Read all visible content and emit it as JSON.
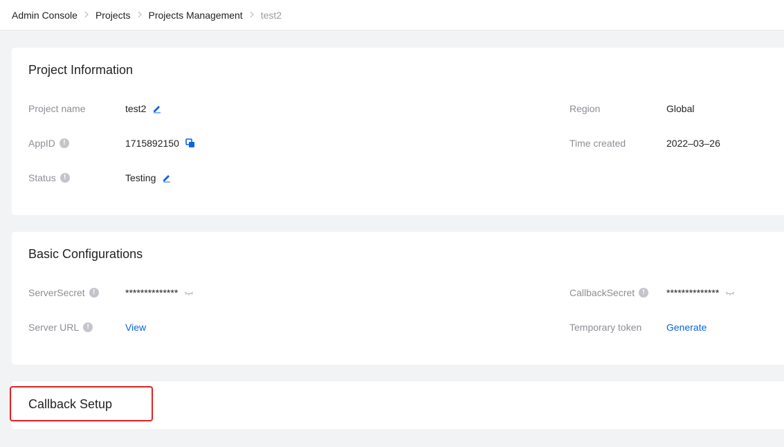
{
  "breadcrumb": {
    "items": [
      "Admin Console",
      "Projects",
      "Projects Management"
    ],
    "current": "test2",
    "separator": ">"
  },
  "project_info": {
    "title": "Project Information",
    "project_name": {
      "label": "Project name",
      "value": "test2"
    },
    "app_id": {
      "label": "AppID",
      "value": "1715892150"
    },
    "status": {
      "label": "Status",
      "value": "Testing"
    },
    "region": {
      "label": "Region",
      "value": "Global"
    },
    "time_created": {
      "label": "Time created",
      "value": "2022–03–26"
    }
  },
  "basic_config": {
    "title": "Basic Configurations",
    "server_secret": {
      "label": "ServerSecret",
      "value": "**************"
    },
    "server_url": {
      "label": "Server URL",
      "link": "View"
    },
    "callback_secret": {
      "label": "CallbackSecret",
      "value": "**************"
    },
    "temporary_token": {
      "label": "Temporary token",
      "link": "Generate"
    }
  },
  "callback_setup": {
    "title": "Callback Setup"
  },
  "icons": {
    "info": "info-icon",
    "edit": "edit-icon",
    "copy": "copy-icon",
    "hidden": "eye-closed-icon",
    "chevron": "chevron-right-icon"
  },
  "colors": {
    "accent": "#0a64e6",
    "highlight": "#e02020",
    "background": "#f2f3f5"
  }
}
